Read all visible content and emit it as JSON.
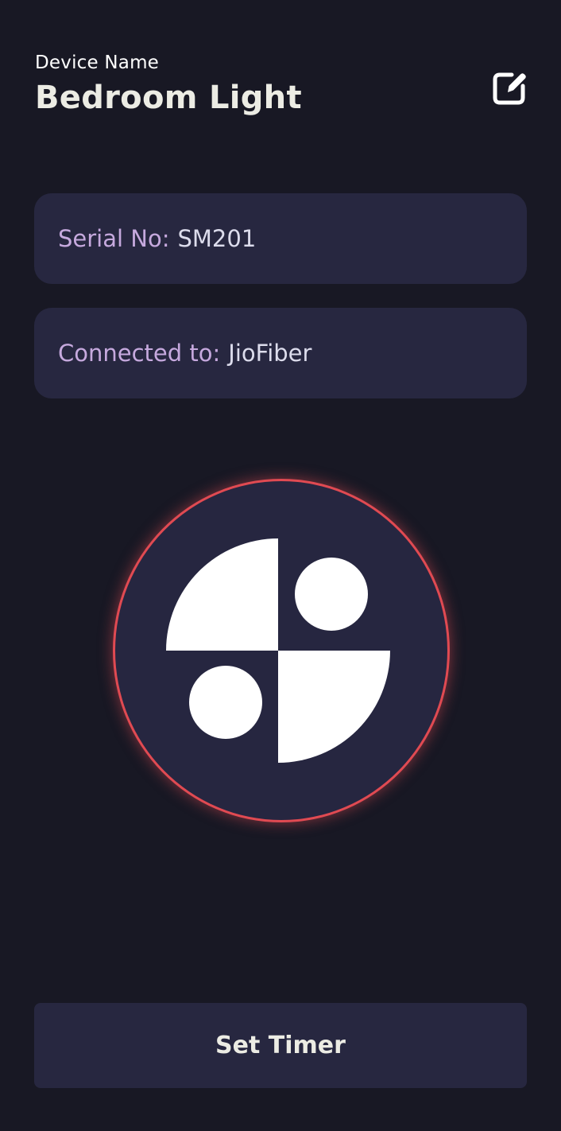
{
  "header": {
    "label": "Device Name",
    "title": "Bedroom Light",
    "edit_icon": "edit-icon"
  },
  "info": {
    "serial_key": "Serial No:",
    "serial_value": "SM201",
    "connection_key": "Connected to:",
    "connection_value": "JioFiber"
  },
  "power": {
    "icon": "device-logo-icon",
    "ring_color": "#e04a52"
  },
  "footer": {
    "timer_label": "Set Timer"
  },
  "colors": {
    "background": "#181824",
    "card": "#272740",
    "label_accent": "#c6a9de"
  }
}
